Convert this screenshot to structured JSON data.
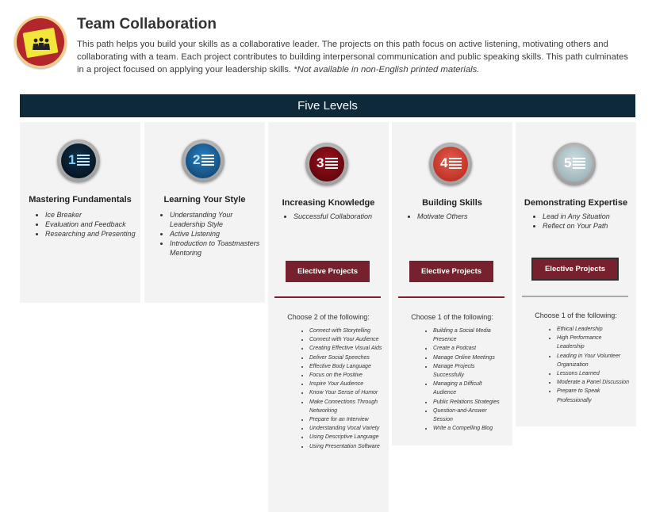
{
  "header": {
    "title": "Team Collaboration",
    "description": "This path helps you build your skills as a collaborative leader. The projects on this path focus on active listening, motivating others and collaborating with a team. Each project contributes to building interpersonal communication and public speaking skills. This path culminates in a project focused on applying your leadership skills.",
    "note": "*Not available in non-English printed materials."
  },
  "levels_title": "Five Levels",
  "levels": [
    {
      "number": "1",
      "title": "Mastering Fundamentals",
      "projects": [
        "Ice Breaker",
        "Evaluation and Feedback",
        "Researching and Presenting"
      ]
    },
    {
      "number": "2",
      "title": "Learning Your Style",
      "projects": [
        "Understanding Your Leadership Style",
        "Active Listening",
        "Introduction to Toastmasters Mentoring"
      ]
    },
    {
      "number": "3",
      "title": "Increasing Knowledge",
      "projects": [
        "Successful Collaboration"
      ],
      "elective_label": "Elective Projects",
      "choose": "Choose 2 of the following:",
      "electives": [
        "Connect with Storytelling",
        "Connect with Your Audience",
        "Creating Effective Visual Aids",
        "Deliver Social Speeches",
        "Effective Body Language",
        "Focus on the Positive",
        "Inspire Your Audience",
        "Know Your Sense of Humor",
        "Make Connections Through Networking",
        "Prepare for an Interview",
        "Understanding Vocal Variety",
        "Using Descriptive Language",
        "Using Presentation Software"
      ]
    },
    {
      "number": "4",
      "title": "Building Skills",
      "projects": [
        "Motivate Others"
      ],
      "elective_label": "Elective Projects",
      "choose": "Choose 1 of the following:",
      "electives": [
        "Building a Social Media Presence",
        "Create a Podcast",
        "Manage Online Meetings",
        "Manage Projects Successfully",
        "Managing a Difficult Audience",
        "Public Relations Strategies",
        "Question-and-Answer Session",
        "Write a Compelling Blog"
      ]
    },
    {
      "number": "5",
      "title": "Demonstrating Expertise",
      "projects": [
        "Lead in Any Situation",
        "Reflect on Your Path"
      ],
      "elective_label": "Elective Projects",
      "choose": "Choose 1 of the following:",
      "electives": [
        "Ethical Leadership",
        "High Performance Leadership",
        "Leading in Your Volunteer Organization",
        "Lessons Learned",
        "Moderate a Panel Discussion",
        "Prepare to Speak Professionally"
      ]
    }
  ],
  "colors": {
    "banner": "#0e2a3a",
    "elective_button": "#77202e",
    "column_bg": "#f3f3f3"
  }
}
